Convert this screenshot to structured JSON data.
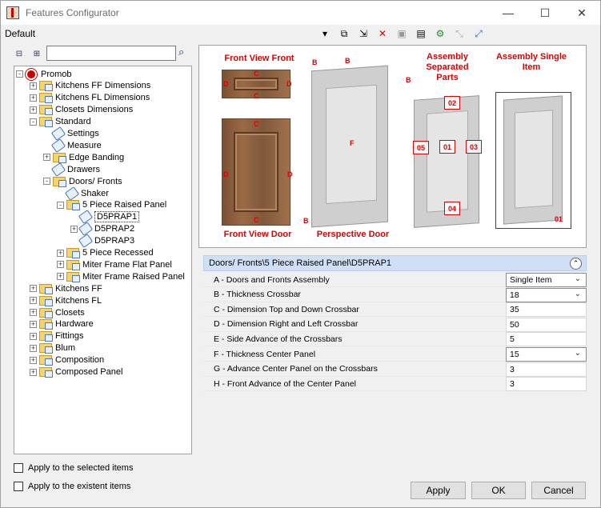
{
  "window": {
    "title": "Features Configurator"
  },
  "toolbar": {
    "profile": "Default"
  },
  "tree": [
    {
      "label": "Promob",
      "indent": 0,
      "exp": "-",
      "icon": "root"
    },
    {
      "label": "Kitchens FF Dimensions",
      "indent": 1,
      "exp": "+",
      "icon": "folder"
    },
    {
      "label": "Kitchens FL Dimensions",
      "indent": 1,
      "exp": "+",
      "icon": "folder"
    },
    {
      "label": "Closets Dimensions",
      "indent": 1,
      "exp": "+",
      "icon": "folder"
    },
    {
      "label": "Standard",
      "indent": 1,
      "exp": "-",
      "icon": "folder"
    },
    {
      "label": "Settings",
      "indent": 2,
      "exp": "",
      "icon": "tag"
    },
    {
      "label": "Measure",
      "indent": 2,
      "exp": "",
      "icon": "tag"
    },
    {
      "label": "Edge Banding",
      "indent": 2,
      "exp": "+",
      "icon": "folder"
    },
    {
      "label": "Drawers",
      "indent": 2,
      "exp": "",
      "icon": "tag"
    },
    {
      "label": "Doors/ Fronts",
      "indent": 2,
      "exp": "-",
      "icon": "folder"
    },
    {
      "label": "Shaker",
      "indent": 3,
      "exp": "",
      "icon": "tag"
    },
    {
      "label": "5 Piece Raised Panel",
      "indent": 3,
      "exp": "-",
      "icon": "folder"
    },
    {
      "label": "D5PRAP1",
      "indent": 4,
      "exp": "",
      "icon": "tag",
      "selected": true
    },
    {
      "label": "D5PRAP2",
      "indent": 4,
      "exp": "+",
      "icon": "tag"
    },
    {
      "label": "D5PRAP3",
      "indent": 4,
      "exp": "",
      "icon": "tag"
    },
    {
      "label": "5 Piece Recessed",
      "indent": 3,
      "exp": "+",
      "icon": "folder"
    },
    {
      "label": "Miter Frame Flat Panel",
      "indent": 3,
      "exp": "+",
      "icon": "folder"
    },
    {
      "label": "Miter Frame Raised Panel",
      "indent": 3,
      "exp": "+",
      "icon": "folder"
    },
    {
      "label": "Kitchens FF",
      "indent": 1,
      "exp": "+",
      "icon": "folder"
    },
    {
      "label": "Kitchens FL",
      "indent": 1,
      "exp": "+",
      "icon": "folder"
    },
    {
      "label": "Closets",
      "indent": 1,
      "exp": "+",
      "icon": "folder"
    },
    {
      "label": "Hardware",
      "indent": 1,
      "exp": "+",
      "icon": "folder"
    },
    {
      "label": "Fittings",
      "indent": 1,
      "exp": "+",
      "icon": "folder"
    },
    {
      "label": "Blum",
      "indent": 1,
      "exp": "+",
      "icon": "folder"
    },
    {
      "label": "Composition",
      "indent": 1,
      "exp": "+",
      "icon": "folder"
    },
    {
      "label": "Composed Panel",
      "indent": 1,
      "exp": "+",
      "icon": "folder"
    }
  ],
  "checkboxes": {
    "selected_items": "Apply to the selected items",
    "existent_items": "Apply to the existent items"
  },
  "image_labels": {
    "front_view_front": "Front View Front",
    "front_view_door": "Front View Door",
    "perspective_door": "Perspective Door",
    "assembly_separated": "Assembly Separated Parts",
    "assembly_single": "Assembly Single Item",
    "b": "B",
    "c": "C",
    "d": "D",
    "f": "F",
    "part_01": "01",
    "part_02": "02",
    "part_03": "03",
    "part_04": "04",
    "part_05": "05"
  },
  "section": {
    "path": "Doors/ Fronts\\5 Piece Raised Panel\\D5PRAP1"
  },
  "properties": [
    {
      "label": "A - Doors and Fronts Assembly",
      "value": "Single Item",
      "dropdown": true
    },
    {
      "label": "B - Thickness Crossbar",
      "value": "18",
      "dropdown": true
    },
    {
      "label": "C - Dimension Top and Down Crossbar",
      "value": "35",
      "dropdown": false
    },
    {
      "label": "D - Dimension Right and Left Crossbar",
      "value": "50",
      "dropdown": false
    },
    {
      "label": "E - Side Advance of the Crossbars",
      "value": "5",
      "dropdown": false
    },
    {
      "label": "F - Thickness Center Panel",
      "value": "15",
      "dropdown": true
    },
    {
      "label": "G - Advance Center Panel on the Crossbars",
      "value": "3",
      "dropdown": false
    },
    {
      "label": "H - Front Advance of the Center Panel",
      "value": "3",
      "dropdown": false
    }
  ],
  "buttons": {
    "apply": "Apply",
    "ok": "OK",
    "cancel": "Cancel"
  },
  "colors": {
    "annotation_red": "#e00000",
    "header_blue": "#cfe0f6"
  }
}
